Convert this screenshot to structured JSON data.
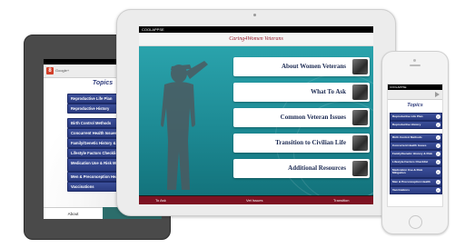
{
  "landscape_ipad": {
    "status": {
      "carrier": "COOLAPPSE",
      "time": "",
      "battery": ""
    },
    "header_title": "Caring4Women Veterans",
    "menu_items": [
      {
        "label": "About Women Veterans"
      },
      {
        "label": "What To Ask"
      },
      {
        "label": "Common Veteran Issues"
      },
      {
        "label": "Transition to Civilian Life"
      },
      {
        "label": "Additional Resources"
      }
    ],
    "tabs": [
      {
        "label": "To Ask"
      },
      {
        "label": "Vet Issues"
      },
      {
        "label": "Transition"
      }
    ]
  },
  "mini_ipad": {
    "browser": {
      "logo": "8",
      "title": "Google+"
    },
    "title": "Topics",
    "items": [
      {
        "label": "Reproductive Life Plan"
      },
      {
        "label": "Reproductive History"
      },
      {
        "label": "Birth Control Methods"
      },
      {
        "label": "Concurrent Health Issues"
      },
      {
        "label": "Family/Genetic History & Risk"
      },
      {
        "label": "Lifestyle Factors Checklist"
      },
      {
        "label": "Medication Use & Risk Mitigation"
      },
      {
        "label": "Men & Preconception Health"
      },
      {
        "label": "Vaccinations"
      }
    ],
    "tabs": {
      "about": "About",
      "topics": "Topics"
    }
  },
  "iphone": {
    "status": {
      "carrier": "COOLAPPSE",
      "time": ""
    },
    "title": "Topics",
    "items": [
      {
        "label": "Reproductive Life Plan"
      },
      {
        "label": "Reproductive History"
      },
      {
        "label": "Birth Control Methods"
      },
      {
        "label": "Concurrent Health Issues"
      },
      {
        "label": "Family/Genetic History & Risk"
      },
      {
        "label": "Lifestyle Factors Checklist"
      },
      {
        "label": "Medication Use & Risk Mitigation"
      },
      {
        "label": "Men & Preconception Health"
      },
      {
        "label": "Vaccinations"
      }
    ]
  },
  "icons": {
    "chevron": "chevron-right-icon",
    "share": "share-icon"
  },
  "colors": {
    "topic_button": "#2a3b80",
    "teal_bg": "#1d8a94",
    "tab_bar_maroon": "#7d1222",
    "topics_tab": "#2c6d6b"
  }
}
